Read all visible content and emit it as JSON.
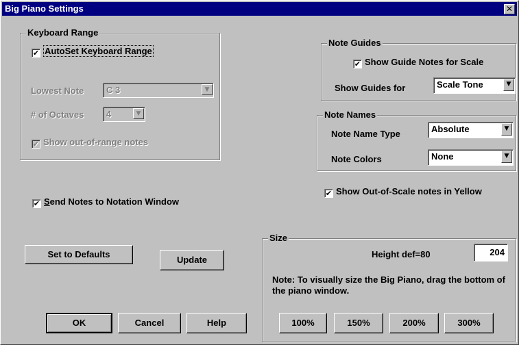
{
  "window": {
    "title": "Big Piano Settings",
    "close_glyph": "✕"
  },
  "keyboard_range": {
    "legend": "Keyboard Range",
    "autoset_label": "AutoSet Keyboard Range",
    "autoset_checked": true,
    "lowest_note_label": "Lowest Note",
    "lowest_note_value": "C 3",
    "octaves_label": "# of Octaves",
    "octaves_value": "4",
    "show_out_of_range_label": "Show out-of-range notes",
    "show_out_of_range_checked": true
  },
  "note_guides": {
    "legend": "Note Guides",
    "show_guide_notes_label": "Show Guide Notes for Scale",
    "show_guide_notes_checked": true,
    "show_guides_for_label": "Show Guides for",
    "show_guides_for_value": "Scale Tone"
  },
  "note_names": {
    "legend": "Note Names",
    "type_label": "Note Name Type",
    "type_value": "Absolute",
    "colors_label": "Note Colors",
    "colors_value": "None"
  },
  "out_of_scale": {
    "label": "Show Out-of-Scale notes in Yellow",
    "checked": true
  },
  "send_notes": {
    "label_first": "S",
    "label_rest": "end Notes to Notation Window",
    "checked": true
  },
  "size": {
    "legend": "Size",
    "height_label": "Height def=80",
    "height_value": "204",
    "note": "Note: To visually size the Big Piano, drag the bottom of the piano window.",
    "presets": [
      "100%",
      "150%",
      "200%",
      "300%"
    ]
  },
  "buttons": {
    "set_defaults": "Set to Defaults",
    "update": "Update",
    "ok": "OK",
    "cancel": "Cancel",
    "help": "Help"
  },
  "check_glyph": "✔",
  "arrow_glyph": "▼"
}
